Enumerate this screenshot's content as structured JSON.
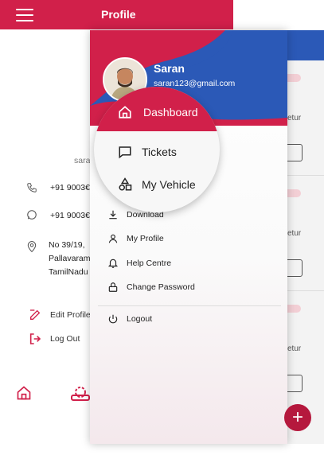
{
  "header": {
    "title": "Profile"
  },
  "profile": {
    "username_partial": "sara",
    "phone1": "+91 9003€",
    "phone2": "+91 9003€",
    "address_line1": "No 39/19,",
    "address_line2": "Pallavaram",
    "address_line3": "TamilNadu",
    "edit_label": "Edit Profile",
    "logout_label": "Log Out"
  },
  "right_list": {
    "text_snippet": "etur"
  },
  "drawer": {
    "user_name": "Saran",
    "user_email": "saran123@gmail.com",
    "items": [
      {
        "label": "Dashboard",
        "icon": "home-icon"
      },
      {
        "label": "Tickets",
        "icon": "chat-icon"
      },
      {
        "label": "My Vehicle",
        "icon": "shapes-icon"
      },
      {
        "label": "Download",
        "icon": "download-icon"
      },
      {
        "label": "My Profile",
        "icon": "person-icon"
      },
      {
        "label": "Help Centre",
        "icon": "bell-icon"
      },
      {
        "label": "Change Password",
        "icon": "lock-icon"
      },
      {
        "label": "Logout",
        "icon": "power-icon"
      }
    ]
  },
  "fab": {
    "label": "+"
  },
  "colors": {
    "primary": "#d1204a",
    "blue": "#2b59b7"
  }
}
